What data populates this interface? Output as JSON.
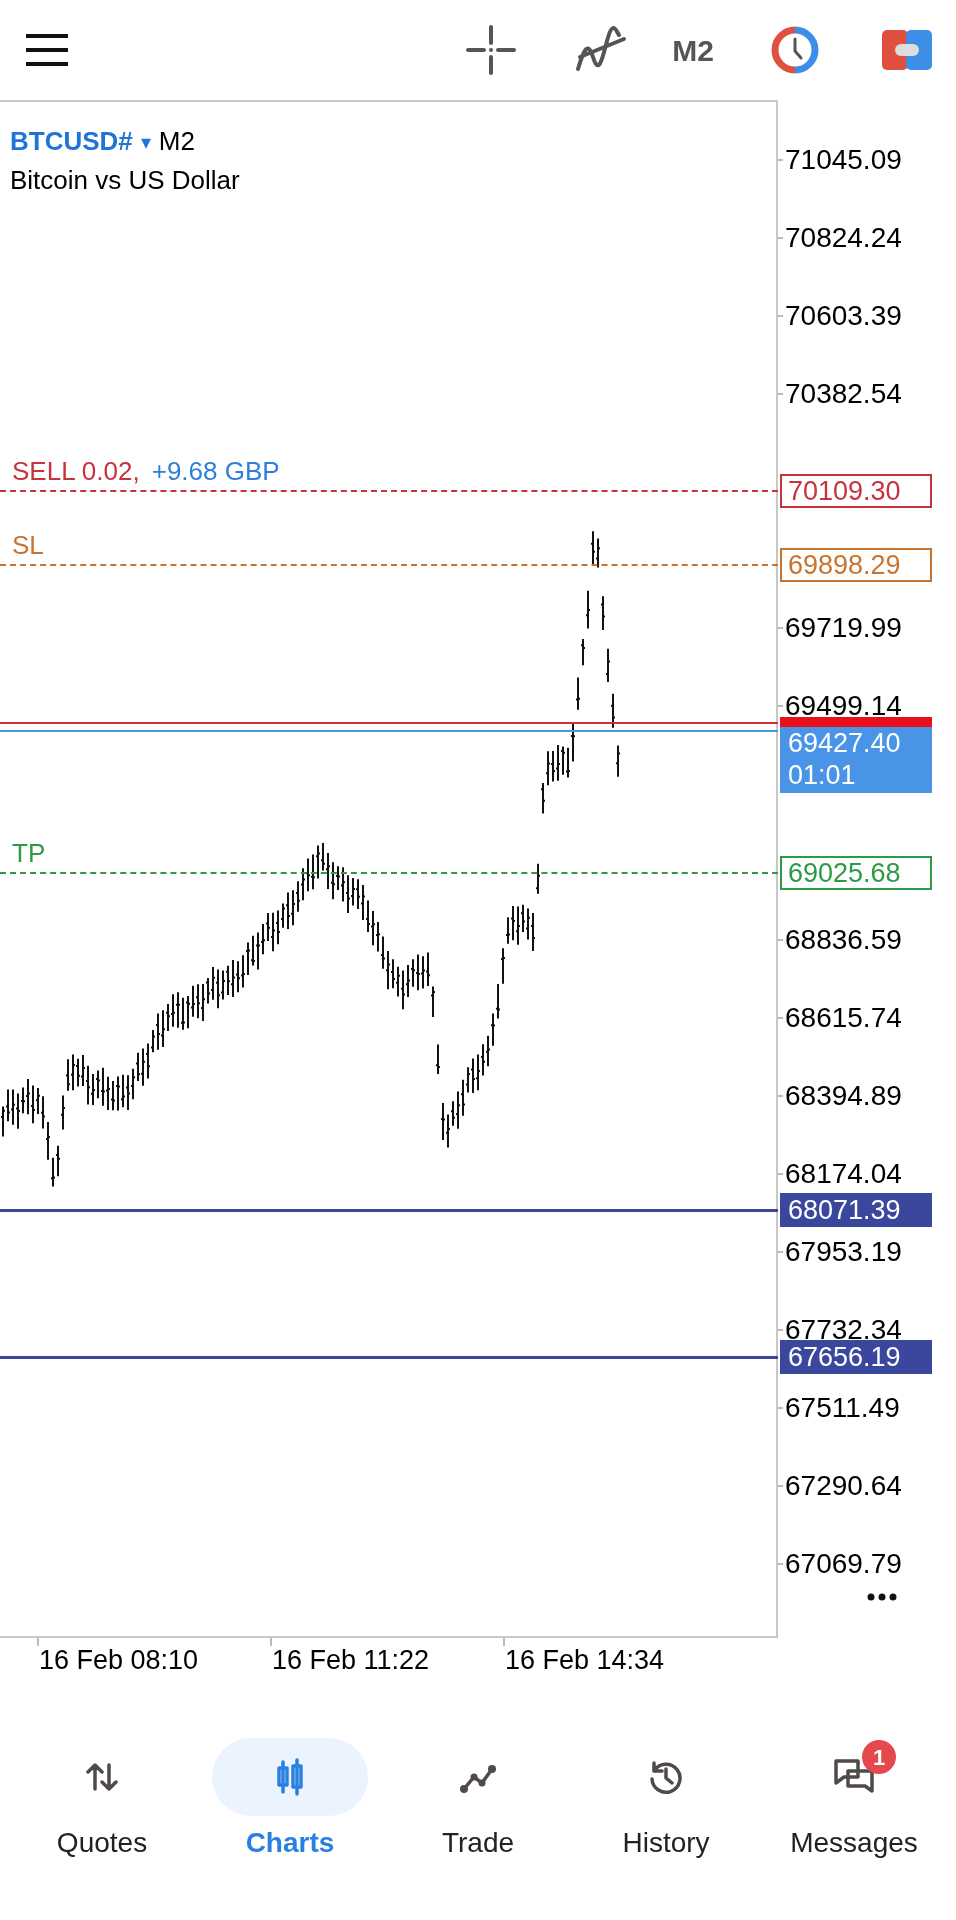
{
  "toolbar": {
    "timeframe": "M2"
  },
  "chart": {
    "symbol": "BTCUSD#",
    "dropdown_glyph": "▾",
    "timeframe": "M2",
    "description": "Bitcoin vs US Dollar",
    "price_axis": [
      "71045.09",
      "70824.24",
      "70603.39",
      "70382.54",
      "69719.99",
      "69499.14",
      "68836.59",
      "68615.74",
      "68394.89",
      "68174.04",
      "67953.19",
      "67732.34",
      "67511.49",
      "67290.64",
      "67069.79"
    ],
    "levels": [
      {
        "kind": "order",
        "label": "SELL 0.02,",
        "profit": "+9.68 GBP",
        "price": "70109.30",
        "color": "#c8323c"
      },
      {
        "kind": "order",
        "label": "SL",
        "price": "69898.29",
        "color": "#c8742e"
      },
      {
        "kind": "order",
        "label": "TP",
        "price": "69025.68",
        "color": "#2f9a46"
      },
      {
        "kind": "alert",
        "price": "68071.39",
        "color": "#3a479c"
      },
      {
        "kind": "alert",
        "price": "67656.19",
        "color": "#3a479c"
      }
    ],
    "current_price": {
      "price": "69427.40",
      "countdown": "01:01"
    },
    "time_axis": [
      "16 Feb 08:10",
      "16 Feb 11:22",
      "16 Feb 14:34"
    ]
  },
  "nav": [
    {
      "kind": "quotes",
      "label": "Quotes",
      "selected": false
    },
    {
      "kind": "charts",
      "label": "Charts",
      "selected": true
    },
    {
      "kind": "trade",
      "label": "Trade",
      "selected": false
    },
    {
      "kind": "history",
      "label": "History",
      "selected": false
    },
    {
      "kind": "messages",
      "label": "Messages",
      "selected": false,
      "badge": "1"
    }
  ]
}
